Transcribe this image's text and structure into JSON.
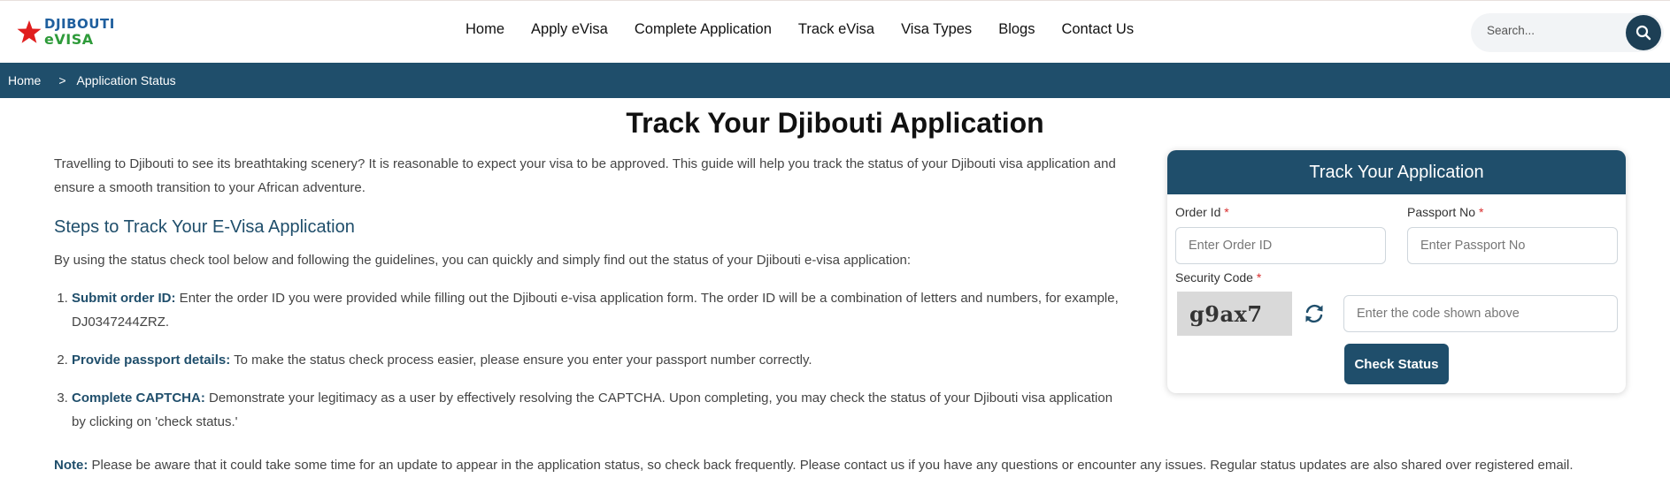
{
  "brand": {
    "line1": "DJIBOUTI",
    "line2": "eVISA",
    "star_color": "#e01e1e",
    "line1_color": "#1f5f9e",
    "line2_color": "#2e9b3a",
    "icon": "star-icon"
  },
  "nav": {
    "items": [
      {
        "label": "Home"
      },
      {
        "label": "Apply eVisa"
      },
      {
        "label": "Complete Application"
      },
      {
        "label": "Track eVisa"
      },
      {
        "label": "Visa Types"
      },
      {
        "label": "Blogs"
      },
      {
        "label": "Contact Us"
      }
    ]
  },
  "search": {
    "placeholder": "Search...",
    "icon": "search-icon"
  },
  "breadcrumb": {
    "home": "Home",
    "separator": ">",
    "current": "Application Status"
  },
  "main": {
    "title": "Track Your Djibouti Application",
    "intro": "Travelling to Djibouti to see its breathtaking scenery? It is reasonable to expect your visa to be approved. This guide will help you track the status of your Djibouti visa application and ensure a smooth transition to your African adventure.",
    "steps_heading": "Steps to Track Your E-Visa Application",
    "steps_intro": "By using the status check tool below and following the guidelines, you can quickly and simply find out the status of your Djibouti e-visa application:",
    "steps": [
      {
        "title": "Submit order ID:",
        "text": " Enter the order ID you were provided while filling out the Djibouti e-visa application form. The order ID will be a combination of letters and numbers, for example, DJ0347244ZRZ."
      },
      {
        "title": "Provide passport details:",
        "text": " To make the status check process easier, please ensure you enter your passport number correctly."
      },
      {
        "title": "Complete CAPTCHA:",
        "text": " Demonstrate your legitimacy as a user by effectively resolving the CAPTCHA. Upon completing, you may check the status of your Djibouti visa application by clicking on 'check status.'"
      }
    ],
    "note_label": "Note:",
    "note_text": " Please be aware that it could take some time for an update to appear in the application status, so check back frequently. Please contact us if you have any questions or encounter any issues. Regular status updates are also shared over registered email."
  },
  "form": {
    "title": "Track Your Application",
    "order_label": "Order Id",
    "order_placeholder": "Enter Order ID",
    "passport_label": "Passport No",
    "passport_placeholder": "Enter Passport No",
    "security_label": "Security Code",
    "required_mark": "*",
    "captcha_text": "g9ax7",
    "code_placeholder": "Enter the code shown above",
    "refresh_icon": "refresh-icon",
    "submit_label": "Check Status"
  },
  "colors": {
    "primary": "#1f4e6b",
    "required": "#d92d2d"
  }
}
